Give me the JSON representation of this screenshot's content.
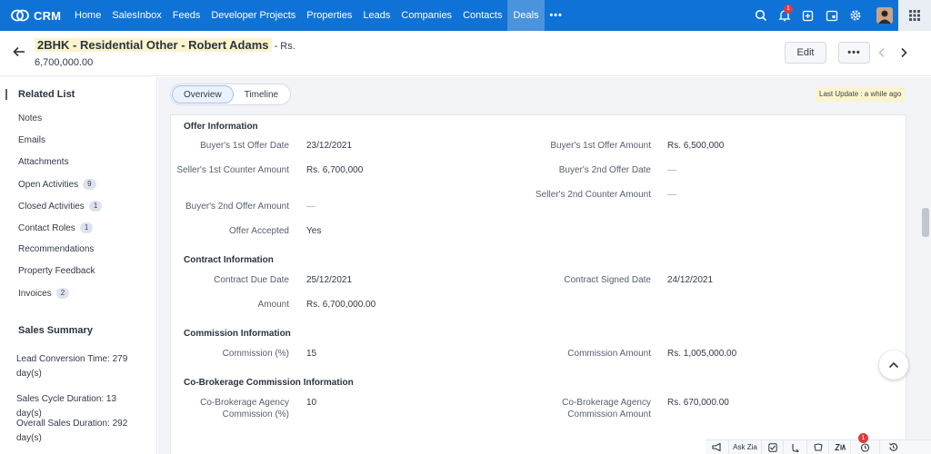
{
  "nav": {
    "brand": "CRM",
    "items": [
      {
        "label": "Home",
        "active": false
      },
      {
        "label": "SalesInbox",
        "active": false
      },
      {
        "label": "Feeds",
        "active": false
      },
      {
        "label": "Developer Projects",
        "active": false
      },
      {
        "label": "Properties",
        "active": false
      },
      {
        "label": "Leads",
        "active": false
      },
      {
        "label": "Companies",
        "active": false
      },
      {
        "label": "Contacts",
        "active": false
      },
      {
        "label": "Deals",
        "active": true
      }
    ],
    "more_label": "•••",
    "notification_count": "1"
  },
  "header": {
    "title": "2BHK - Residential Other - Robert Adams",
    "amount_line": "- Rs. 6,700,000.00",
    "edit_label": "Edit",
    "more_label": "•••"
  },
  "sidebar": {
    "related_title": "Related List",
    "items": [
      {
        "label": "Notes",
        "badge": ""
      },
      {
        "label": "Emails",
        "badge": ""
      },
      {
        "label": "Attachments",
        "badge": ""
      },
      {
        "label": "Open Activities",
        "badge": "9"
      },
      {
        "label": "Closed Activities",
        "badge": "1"
      },
      {
        "label": "Contact Roles",
        "badge": "1"
      },
      {
        "label": "Recommendations",
        "badge": ""
      },
      {
        "label": "Property Feedback",
        "badge": ""
      },
      {
        "label": "Invoices",
        "badge": "2"
      }
    ],
    "summary_title": "Sales Summary",
    "summary": [
      "Lead Conversion Time: 279 day(s)",
      "Sales Cycle Duration: 13 day(s)",
      "Overall Sales Duration: 292 day(s)"
    ]
  },
  "tabs": {
    "overview": "Overview",
    "timeline": "Timeline",
    "active": "overview"
  },
  "last_update": "Last Update : a while ago",
  "sections": {
    "offer": {
      "title": "Offer Information",
      "buyer_1st_offer_date_label": "Buyer's 1st Offer Date",
      "buyer_1st_offer_date": "23/12/2021",
      "buyer_1st_offer_amount_label": "Buyer's 1st Offer Amount",
      "buyer_1st_offer_amount": "Rs. 6,500,000",
      "seller_1st_counter_amount_label": "Seller's 1st Counter Amount",
      "seller_1st_counter_amount": "Rs. 6,700,000",
      "buyer_2nd_offer_date_label": "Buyer's 2nd Offer Date",
      "buyer_2nd_offer_date": "—",
      "buyer_2nd_offer_amount_label": "Buyer's 2nd Offer Amount",
      "buyer_2nd_offer_amount": "—",
      "seller_2nd_counter_amount_label": "Seller's 2nd Counter Amount",
      "seller_2nd_counter_amount": "—",
      "offer_accepted_label": "Offer Accepted",
      "offer_accepted": "Yes"
    },
    "contract": {
      "title": "Contract Information",
      "due_date_label": "Contract Due Date",
      "due_date": "25/12/2021",
      "signed_date_label": "Contract Signed Date",
      "signed_date": "24/12/2021",
      "amount_label": "Amount",
      "amount": "Rs. 6,700,000.00"
    },
    "commission": {
      "title": "Commission Information",
      "percent_label": "Commission (%)",
      "percent": "15",
      "amount_label": "Commission Amount",
      "amount": "Rs. 1,005,000.00"
    },
    "cobrokerage": {
      "title": "Co-Brokerage Commission Information",
      "agency_percent_label": "Co-Brokerage Agency Commission (%)",
      "agency_percent": "10",
      "agency_amount_label": "Co-Brokerage Agency Commission Amount",
      "agency_amount": "Rs. 670,000.00"
    }
  },
  "bottombar": {
    "ask_zia": "Ask Zia",
    "alarm_badge": "1"
  },
  "colors": {
    "nav_bg": "#0f72d6",
    "nav_active": "#4a93dd",
    "highlight": "#fbf4cc",
    "badge_red": "#e23a3a"
  }
}
